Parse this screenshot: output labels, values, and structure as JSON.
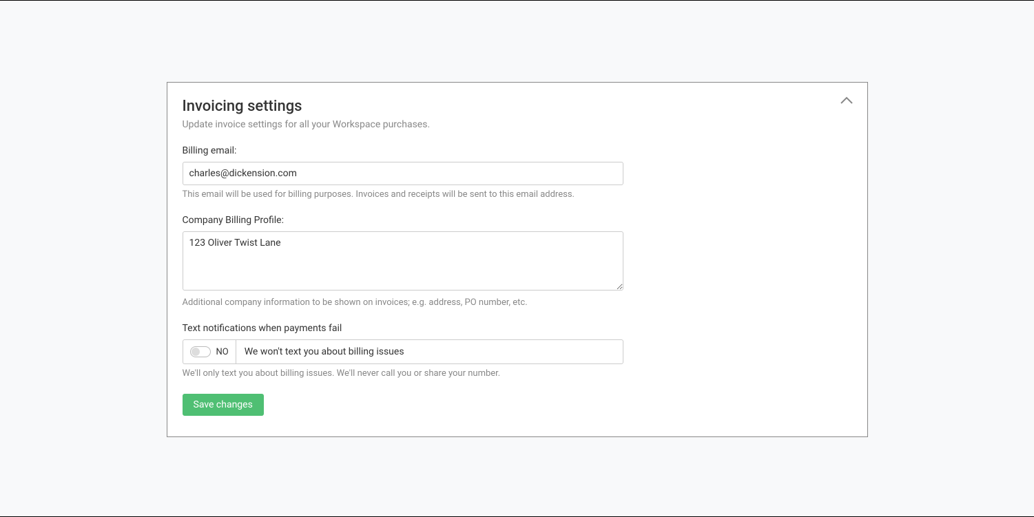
{
  "panel": {
    "title": "Invoicing settings",
    "subtitle": "Update invoice settings for all your Workspace purchases."
  },
  "billing_email": {
    "label": "Billing email:",
    "value": "charles@dickension.com",
    "help": "This email will be used for billing purposes. Invoices and receipts will be sent to this email address."
  },
  "billing_profile": {
    "label": "Company Billing Profile:",
    "value": "123 Oliver Twist Lane",
    "help": "Additional company information to be shown on invoices; e.g. address, PO number, etc."
  },
  "text_notifications": {
    "label": "Text notifications when payments fail",
    "state": "NO",
    "description": "We won't text you about billing issues",
    "help": "We'll only text you about billing issues. We'll never call you or share your number."
  },
  "actions": {
    "save": "Save changes"
  }
}
